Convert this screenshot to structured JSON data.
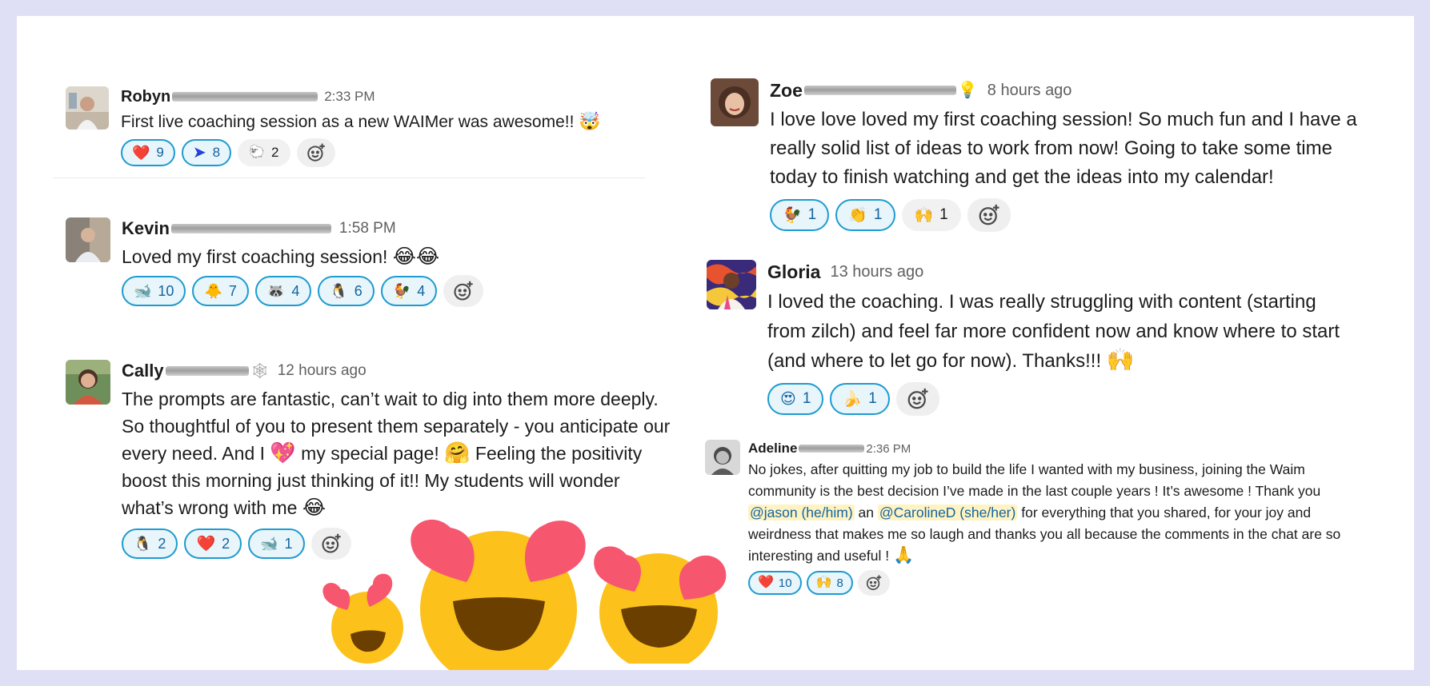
{
  "messages": {
    "robyn": {
      "name": "Robyn",
      "time": "2:33 PM",
      "text": "First live coaching session as a new WAIMer was awesome!!",
      "emoji": "🤯",
      "reactions": [
        {
          "emoji": "❤️",
          "count": "9"
        },
        {
          "emoji": "➤",
          "count": "8"
        },
        {
          "emoji": "🐑",
          "count": "2"
        }
      ]
    },
    "kevin": {
      "name": "Kevin",
      "time": "1:58 PM",
      "text": "Loved my first coaching session!",
      "emoji": "😂😂",
      "reactions": [
        {
          "emoji": "🐋",
          "count": "10"
        },
        {
          "emoji": "🐥",
          "count": "7"
        },
        {
          "emoji": "🦝",
          "count": "4"
        },
        {
          "emoji": "🐧",
          "count": "6"
        },
        {
          "emoji": "🐓",
          "count": "4"
        }
      ]
    },
    "cally": {
      "name": "Cally",
      "status_icon": "🕸",
      "time": "12 hours ago",
      "text1": "The prompts are fantastic, can’t wait to dig into them more deeply.",
      "text2": "So thoughtful of you to present them separately - you anticipate our",
      "text3a": "every need. And I",
      "emoji_heart": "💖",
      "text3b": "my special page!",
      "emoji_hug": "🤗",
      "text3c": "Feeling the positivity",
      "text4": "boost this morning just thinking of it!! My students will wonder",
      "text5": "what’s wrong with me",
      "emoji_laugh": "😂",
      "reactions": [
        {
          "emoji": "🐧",
          "count": "2"
        },
        {
          "emoji": "❤️",
          "count": "2"
        },
        {
          "emoji": "🐋",
          "count": "1"
        }
      ]
    },
    "zoe": {
      "name": "Zoe",
      "status_icon": "💡",
      "time": "8 hours ago",
      "text1": "I love love loved my first coaching session! So much fun and I have a",
      "text2": "really solid list of ideas to work from now! Going to take some time",
      "text3": "today to finish watching and get the ideas into my calendar!",
      "reactions": [
        {
          "emoji": "🐓",
          "count": "1"
        },
        {
          "emoji": "👏",
          "count": "1"
        },
        {
          "emoji": "🙌",
          "count": "1"
        }
      ]
    },
    "gloria": {
      "name": "Gloria",
      "time": "13 hours ago",
      "text1": "I loved the coaching. I was really struggling with content (starting",
      "text2": "from zilch) and feel far more confident now and know where to start",
      "text3": "(and where to let go for now). Thanks!!!",
      "emoji": "🙌",
      "reactions": [
        {
          "emoji": "😍",
          "count": "1"
        },
        {
          "emoji": "🍌",
          "count": "1"
        }
      ]
    },
    "adeline": {
      "name": "Adeline",
      "time": "2:36 PM",
      "text1": "No jokes, after quitting my job to build the life I wanted with my business, joining the Waim",
      "text2": "community is the best decision I’ve made in the last couple years ! It’s awesome ! Thank you",
      "mention1": "@jason (he/him)",
      "text3_mid": "an",
      "mention2": "@CarolineD (she/her)",
      "text3_end": "for everything that you shared, for your joy and",
      "text4": "weirdness that makes me so laugh and thanks you all because the comments in the chat are so",
      "text5": "interesting and useful !",
      "emoji": "🙏",
      "reactions": [
        {
          "emoji": "❤️",
          "count": "10"
        },
        {
          "emoji": "🙌",
          "count": "8"
        }
      ]
    }
  },
  "icons": {
    "add_reaction": "add-reaction-icon",
    "decoration": "heart-eyes-emoji"
  },
  "colors": {
    "background": "#dfe0f5",
    "reaction_border": "#1d9bd1",
    "reaction_text": "#1264a3",
    "heart_eye": "#f7566f",
    "emoji_face": "#fcc21b"
  }
}
